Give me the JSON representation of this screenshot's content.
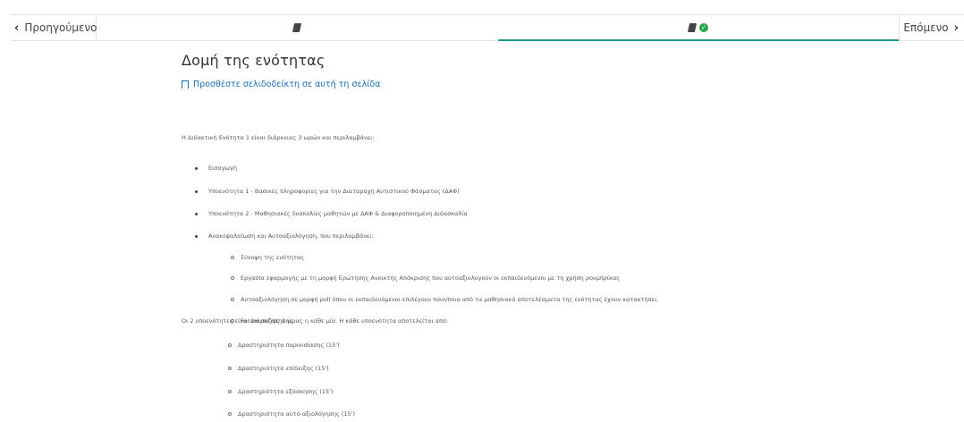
{
  "nav": {
    "prev_label": "Προηγούμενο",
    "next_label": "Επόμενο",
    "tabs": [
      {
        "icon": "book-icon",
        "active": false
      },
      {
        "icon": "book-icon",
        "completed": true,
        "active": true
      }
    ],
    "accent_color": "#1d9a8a",
    "check_color": "#2aa84a"
  },
  "page": {
    "title": "Δομή της ενότητας",
    "bookmark_label": "Προσθέστε σελιδοδείκτη σε αυτή τη σελίδα",
    "intro": "Η Διδακτική Ενότητα 1 είναι διάρκειας 3 ωρών και περιλαμβάνει:",
    "bullets": [
      "Εισαγωγή",
      "Υποενότητα 1 - Βασικές πληροφορίες για την Διαταραχή Αυτιστικού Φάσματος (ΔΑΦ)",
      "Υποενότητα 2 - Μαθησιακές δυσκολίες μαθητών με ΔΑΦ & Διαφοροποιημένη Διδασκαλία",
      "Ανακεφαλαίωση και Αυτοαξιολόγηση, που περιλαμβάνει:"
    ],
    "sub_bullets": [
      "Σύνοψη της ενότητας",
      "Εργασία εφαρμογής με τη μορφή Ερώτησης Ανοικτής Απόκρισης που αυτοαξιολογούν οι εκπαιδευόμενοι με τη χρήση ρουμπρίκας",
      "Αυτοαξιολόγηση σε μορφή poll όπου οι εκπαιδευόμενοι επιλέγουν ποιο/ποια από τα μαθησιακά αποτελέσματα της ενότητας έχουν κατακτήσει.",
      "Forum συζήτησης"
    ],
    "para2": "Οι 2 υποενότητες είναι διάρκειας 1 ώρας η κάθε μία. Η κάθε υποενότητα αποτελείται από:",
    "activities": [
      "Δραστηριότητα παρουσίασης (15')",
      "Δραστηριότητα επίδειξης (15')",
      "Δραστηριότητα εξάσκησης (15')",
      "Δραστηριότητα αυτό-αξιολόγησης (15')"
    ]
  }
}
